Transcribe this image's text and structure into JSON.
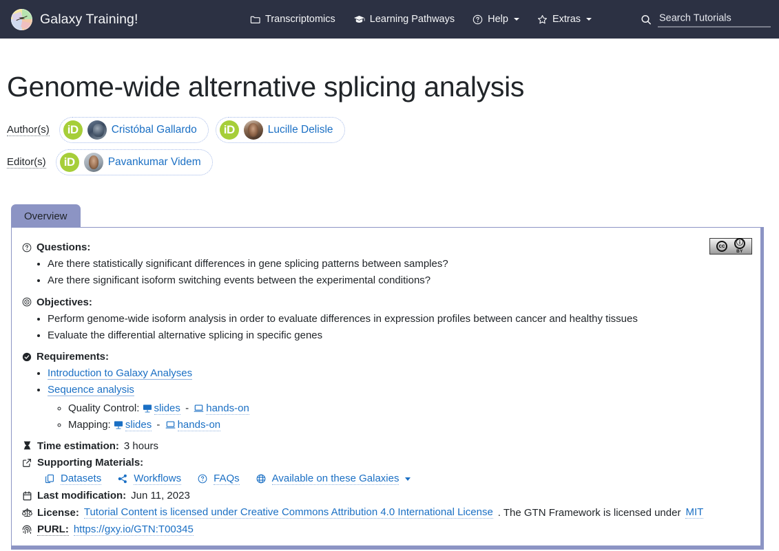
{
  "navbar": {
    "brand": "Galaxy Training!",
    "logo_icon": "galaxy-logo-icon",
    "items": [
      {
        "label": "Transcriptomics",
        "icon": "folder-icon",
        "has_caret": false
      },
      {
        "label": "Learning Pathways",
        "icon": "graduation-cap-icon",
        "has_caret": false
      },
      {
        "label": "Help",
        "icon": "question-circle-icon",
        "has_caret": true
      },
      {
        "label": "Extras",
        "icon": "star-icon",
        "has_caret": true
      }
    ],
    "search": {
      "icon": "search-icon",
      "placeholder": "Search Tutorials",
      "value": ""
    }
  },
  "page": {
    "title": "Genome-wide alternative splicing analysis"
  },
  "authors": {
    "label": "Author(s)",
    "people": [
      {
        "name": "Cristóbal Gallardo",
        "orcid_icon": "orcid-id-icon",
        "avatar_icon": "avatar"
      },
      {
        "name": "Lucille Delisle",
        "orcid_icon": "orcid-id-icon",
        "avatar_icon": "avatar"
      }
    ]
  },
  "editors": {
    "label": "Editor(s)",
    "people": [
      {
        "name": "Pavankumar Videm",
        "orcid_icon": "orcid-id-icon",
        "avatar_icon": "avatar"
      }
    ]
  },
  "tabs": [
    {
      "label": "Overview",
      "active": true
    }
  ],
  "overview": {
    "license_badge": {
      "cc": "cc",
      "by_symbol": "ⓘ",
      "by_label": "BY",
      "alt": "Creative Commons Attribution badge"
    },
    "questions": {
      "icon": "question-circle-icon",
      "heading": "Questions:",
      "items": [
        "Are there statistically significant differences in gene splicing patterns between samples?",
        "Are there significant isoform switching events between the experimental conditions?"
      ]
    },
    "objectives": {
      "icon": "bullseye-icon",
      "heading": "Objectives:",
      "items": [
        "Perform genome-wide isoform analysis in order to evaluate differences in expression profiles between cancer and healthy tissues",
        "Evaluate the differential alternative splicing in specific genes"
      ]
    },
    "requirements": {
      "icon": "check-circle-icon",
      "heading": "Requirements:",
      "items": [
        {
          "label": "Introduction to Galaxy Analyses",
          "sub": []
        },
        {
          "label": "Sequence analysis",
          "sub": [
            {
              "prefix": "Quality Control:",
              "links": [
                {
                  "label": "slides",
                  "icon": "slides-icon"
                },
                {
                  "label": "hands-on",
                  "icon": "laptop-icon"
                }
              ],
              "separator": "-"
            },
            {
              "prefix": "Mapping:",
              "links": [
                {
                  "label": "slides",
                  "icon": "slides-icon"
                },
                {
                  "label": "hands-on",
                  "icon": "laptop-icon"
                }
              ],
              "separator": "-"
            }
          ]
        }
      ]
    },
    "time_estimation": {
      "icon": "hourglass-icon",
      "label": "Time estimation:",
      "value": "3 hours"
    },
    "supporting_materials": {
      "icon": "external-link-icon",
      "label": "Supporting Materials:",
      "items": [
        {
          "label": "Datasets",
          "icon": "copy-files-icon",
          "has_caret": false
        },
        {
          "label": "Workflows",
          "icon": "share-nodes-icon",
          "has_caret": false
        },
        {
          "label": "FAQs",
          "icon": "question-circle-icon",
          "has_caret": false
        },
        {
          "label": "Available on these Galaxies",
          "icon": "globe-icon",
          "has_caret": true
        }
      ]
    },
    "last_modification": {
      "icon": "calendar-icon",
      "label": "Last modification:",
      "value": "Jun 11, 2023"
    },
    "license": {
      "icon": "balance-scale-icon",
      "label": "License:",
      "link_text": "Tutorial Content is licensed under Creative Commons Attribution 4.0 International License",
      "mid_text": ". The GTN Framework is licensed under",
      "link2_text": "MIT"
    },
    "purl": {
      "icon": "fingerprint-icon",
      "label": "PURL:",
      "value": "https://gxy.io/GTN:T00345"
    }
  },
  "colors": {
    "navbar_bg": "#2c3143",
    "accent_periwinkle": "#8c94c4",
    "link_blue": "#1a6fc4",
    "orcid_green": "#a6ce39"
  }
}
